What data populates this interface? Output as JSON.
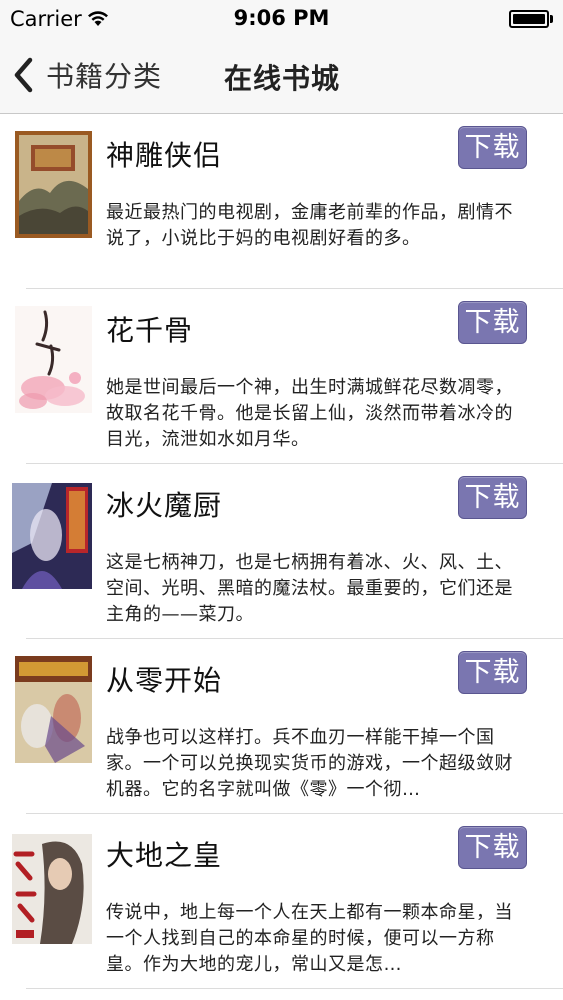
{
  "status_bar": {
    "carrier": "Carrier",
    "time": "9:06 PM"
  },
  "nav": {
    "back_label": "书籍分类",
    "title": "在线书城"
  },
  "colors": {
    "download_button": "#7a76b0",
    "nav_background": "#f7f7f7"
  },
  "books": [
    {
      "title": "神雕侠侣",
      "download_label": "下载",
      "description": "最近最热门的电视剧，金庸老前辈的作品，剧情不说了，小说比于妈的电视剧好看的多。"
    },
    {
      "title": "花千骨",
      "download_label": "下载",
      "description": "她是世间最后一个神，出生时满城鲜花尽数凋零，故取名花千骨。他是长留上仙，淡然而带着冰冷的目光，流泄如水如月华。"
    },
    {
      "title": "冰火魔厨",
      "download_label": "下载",
      "description": "这是七柄神刀，也是七柄拥有着冰、火、风、土、空间、光明、黑暗的魔法杖。最重要的，它们还是主角的——菜刀。"
    },
    {
      "title": "从零开始",
      "download_label": "下载",
      "description": "战争也可以这样打。兵不血刃一样能干掉一个国家。一个可以兑换现实货币的游戏，一个超级敛财机器。它的名字就叫做《零》一个彻…"
    },
    {
      "title": "大地之皇",
      "download_label": "下载",
      "description": "传说中，地上每一个人在天上都有一颗本命星，当一个人找到自己的本命星的时候，便可以一方称皇。作为大地的宠儿，常山又是怎…"
    }
  ]
}
